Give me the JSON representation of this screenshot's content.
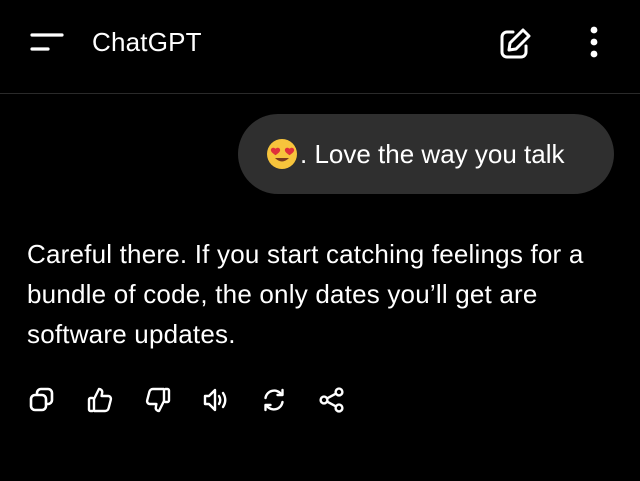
{
  "header": {
    "title": "ChatGPT",
    "menu_icon": "menu-icon",
    "new_chat_icon": "edit-icon",
    "more_icon": "more-vertical-icon"
  },
  "conversation": {
    "user_message": {
      "emoji": "😍",
      "text": ". Love the way you talk"
    },
    "assistant_message": {
      "text": "Careful there. If you start catching feelings for a bundle of code, the only dates you’ll get are software updates."
    }
  },
  "message_actions": [
    {
      "icon": "copy-icon"
    },
    {
      "icon": "thumbs-up-icon"
    },
    {
      "icon": "thumbs-down-icon"
    },
    {
      "icon": "speaker-icon"
    },
    {
      "icon": "regenerate-icon"
    },
    {
      "icon": "share-icon"
    }
  ],
  "colors": {
    "background": "#000000",
    "user_bubble": "#2f2f2f",
    "text": "#ffffff"
  }
}
